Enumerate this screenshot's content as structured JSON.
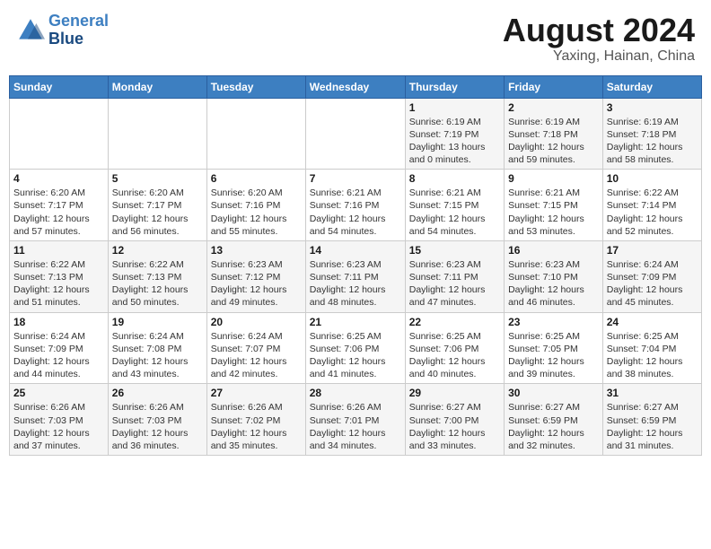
{
  "header": {
    "logo_line1": "General",
    "logo_line2": "Blue",
    "month": "August 2024",
    "location": "Yaxing, Hainan, China"
  },
  "weekdays": [
    "Sunday",
    "Monday",
    "Tuesday",
    "Wednesday",
    "Thursday",
    "Friday",
    "Saturday"
  ],
  "weeks": [
    [
      {
        "day": "",
        "info": ""
      },
      {
        "day": "",
        "info": ""
      },
      {
        "day": "",
        "info": ""
      },
      {
        "day": "",
        "info": ""
      },
      {
        "day": "1",
        "info": "Sunrise: 6:19 AM\nSunset: 7:19 PM\nDaylight: 13 hours\nand 0 minutes."
      },
      {
        "day": "2",
        "info": "Sunrise: 6:19 AM\nSunset: 7:18 PM\nDaylight: 12 hours\nand 59 minutes."
      },
      {
        "day": "3",
        "info": "Sunrise: 6:19 AM\nSunset: 7:18 PM\nDaylight: 12 hours\nand 58 minutes."
      }
    ],
    [
      {
        "day": "4",
        "info": "Sunrise: 6:20 AM\nSunset: 7:17 PM\nDaylight: 12 hours\nand 57 minutes."
      },
      {
        "day": "5",
        "info": "Sunrise: 6:20 AM\nSunset: 7:17 PM\nDaylight: 12 hours\nand 56 minutes."
      },
      {
        "day": "6",
        "info": "Sunrise: 6:20 AM\nSunset: 7:16 PM\nDaylight: 12 hours\nand 55 minutes."
      },
      {
        "day": "7",
        "info": "Sunrise: 6:21 AM\nSunset: 7:16 PM\nDaylight: 12 hours\nand 54 minutes."
      },
      {
        "day": "8",
        "info": "Sunrise: 6:21 AM\nSunset: 7:15 PM\nDaylight: 12 hours\nand 54 minutes."
      },
      {
        "day": "9",
        "info": "Sunrise: 6:21 AM\nSunset: 7:15 PM\nDaylight: 12 hours\nand 53 minutes."
      },
      {
        "day": "10",
        "info": "Sunrise: 6:22 AM\nSunset: 7:14 PM\nDaylight: 12 hours\nand 52 minutes."
      }
    ],
    [
      {
        "day": "11",
        "info": "Sunrise: 6:22 AM\nSunset: 7:13 PM\nDaylight: 12 hours\nand 51 minutes."
      },
      {
        "day": "12",
        "info": "Sunrise: 6:22 AM\nSunset: 7:13 PM\nDaylight: 12 hours\nand 50 minutes."
      },
      {
        "day": "13",
        "info": "Sunrise: 6:23 AM\nSunset: 7:12 PM\nDaylight: 12 hours\nand 49 minutes."
      },
      {
        "day": "14",
        "info": "Sunrise: 6:23 AM\nSunset: 7:11 PM\nDaylight: 12 hours\nand 48 minutes."
      },
      {
        "day": "15",
        "info": "Sunrise: 6:23 AM\nSunset: 7:11 PM\nDaylight: 12 hours\nand 47 minutes."
      },
      {
        "day": "16",
        "info": "Sunrise: 6:23 AM\nSunset: 7:10 PM\nDaylight: 12 hours\nand 46 minutes."
      },
      {
        "day": "17",
        "info": "Sunrise: 6:24 AM\nSunset: 7:09 PM\nDaylight: 12 hours\nand 45 minutes."
      }
    ],
    [
      {
        "day": "18",
        "info": "Sunrise: 6:24 AM\nSunset: 7:09 PM\nDaylight: 12 hours\nand 44 minutes."
      },
      {
        "day": "19",
        "info": "Sunrise: 6:24 AM\nSunset: 7:08 PM\nDaylight: 12 hours\nand 43 minutes."
      },
      {
        "day": "20",
        "info": "Sunrise: 6:24 AM\nSunset: 7:07 PM\nDaylight: 12 hours\nand 42 minutes."
      },
      {
        "day": "21",
        "info": "Sunrise: 6:25 AM\nSunset: 7:06 PM\nDaylight: 12 hours\nand 41 minutes."
      },
      {
        "day": "22",
        "info": "Sunrise: 6:25 AM\nSunset: 7:06 PM\nDaylight: 12 hours\nand 40 minutes."
      },
      {
        "day": "23",
        "info": "Sunrise: 6:25 AM\nSunset: 7:05 PM\nDaylight: 12 hours\nand 39 minutes."
      },
      {
        "day": "24",
        "info": "Sunrise: 6:25 AM\nSunset: 7:04 PM\nDaylight: 12 hours\nand 38 minutes."
      }
    ],
    [
      {
        "day": "25",
        "info": "Sunrise: 6:26 AM\nSunset: 7:03 PM\nDaylight: 12 hours\nand 37 minutes."
      },
      {
        "day": "26",
        "info": "Sunrise: 6:26 AM\nSunset: 7:03 PM\nDaylight: 12 hours\nand 36 minutes."
      },
      {
        "day": "27",
        "info": "Sunrise: 6:26 AM\nSunset: 7:02 PM\nDaylight: 12 hours\nand 35 minutes."
      },
      {
        "day": "28",
        "info": "Sunrise: 6:26 AM\nSunset: 7:01 PM\nDaylight: 12 hours\nand 34 minutes."
      },
      {
        "day": "29",
        "info": "Sunrise: 6:27 AM\nSunset: 7:00 PM\nDaylight: 12 hours\nand 33 minutes."
      },
      {
        "day": "30",
        "info": "Sunrise: 6:27 AM\nSunset: 6:59 PM\nDaylight: 12 hours\nand 32 minutes."
      },
      {
        "day": "31",
        "info": "Sunrise: 6:27 AM\nSunset: 6:59 PM\nDaylight: 12 hours\nand 31 minutes."
      }
    ]
  ]
}
